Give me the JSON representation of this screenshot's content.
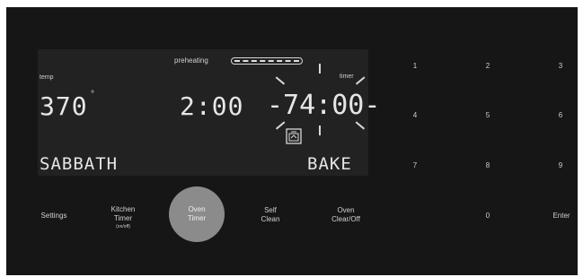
{
  "display": {
    "preheating_label": "preheating",
    "temp_label": "temp",
    "temp_value": "370",
    "degree_mark": "°",
    "clock_value": "2:00",
    "timer_label": "timer",
    "timer_value": "-74:00-",
    "mode_left": "SABBATH",
    "mode_right": "BAKE",
    "preheat_progress_segments": 6,
    "preheat_progress_filled": 6
  },
  "buttons": {
    "settings": "Settings",
    "kitchen_timer_line1": "Kitchen",
    "kitchen_timer_line2": "Timer",
    "kitchen_timer_sub": "(on/off)",
    "oven_timer_line1": "Oven",
    "oven_timer_line2": "Timer",
    "self_clean_line1": "Self",
    "self_clean_line2": "Clean",
    "oven_clear_line1": "Oven",
    "oven_clear_line2": "Clear/Off"
  },
  "keypad": {
    "k1": "1",
    "k2": "2",
    "k3": "3",
    "k4": "4",
    "k5": "5",
    "k6": "6",
    "k7": "7",
    "k8": "8",
    "k9": "9",
    "k0": "0",
    "enter": "Enter"
  },
  "colors": {
    "panel_bg": "#161616",
    "display_bg": "#222222",
    "active_button": "#8b8b8b",
    "text": "#d8d8d8"
  },
  "icons": {
    "oven_lock": "oven-lock-icon"
  }
}
